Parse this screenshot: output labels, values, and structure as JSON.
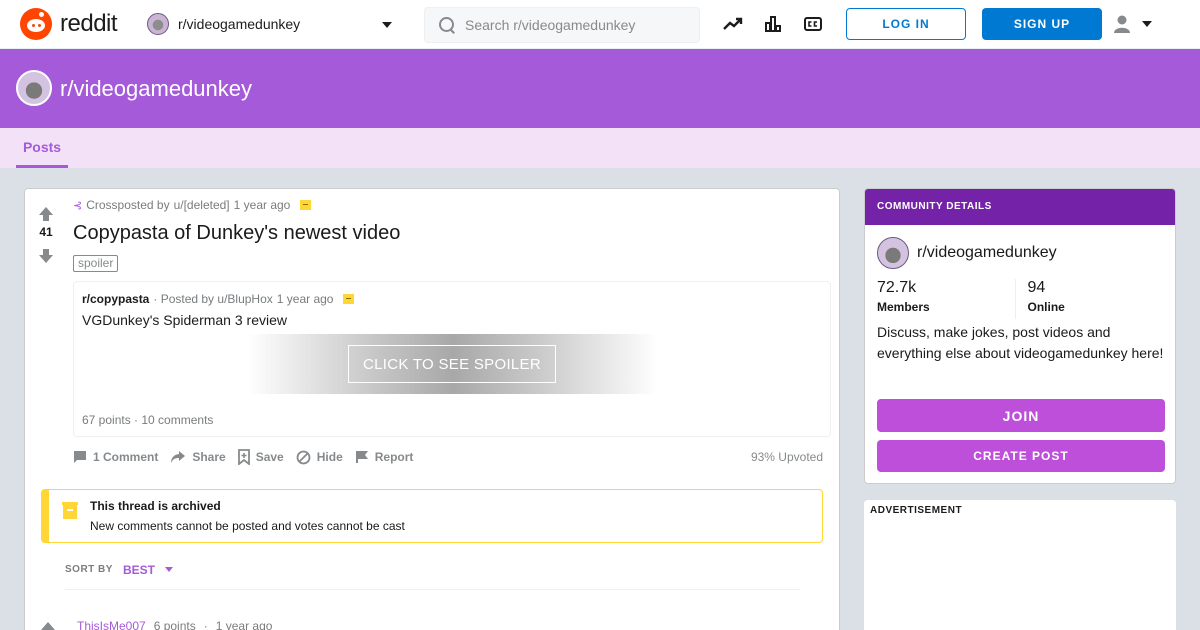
{
  "header": {
    "logo_text": "reddit",
    "community": "r/videogamedunkey",
    "search_placeholder": "Search r/videogamedunkey",
    "icons": [
      "trending-icon",
      "leaderboard-icon",
      "closed-captions-icon",
      "user-icon"
    ],
    "login_label": "LOG IN",
    "signup_label": "SIGN UP"
  },
  "banner": {
    "title": "r/videogamedunkey",
    "color": "#a45ad9"
  },
  "tabs": [
    {
      "label": "Posts"
    }
  ],
  "post": {
    "votes": "41",
    "crosspost_prefix": "Crossposted by",
    "crosspost_user": "u/[deleted]",
    "crosspost_time": "1 year ago",
    "title": "Copypasta of Dunkey's newest video",
    "flair": "spoiler",
    "embed": {
      "subreddit": "r/copypasta",
      "posted_by": "· Posted by u/BlupHox",
      "time": "1 year ago",
      "title": "VGDunkey's Spiderman 3 review",
      "spoiler_label": "CLICK TO SEE SPOILER",
      "footer": "67 points · 10 comments"
    },
    "actions": {
      "comments": "1 Comment",
      "share": "Share",
      "save": "Save",
      "hide": "Hide",
      "report": "Report"
    },
    "upvoted": "93% Upvoted",
    "archived_title": "This thread is archived",
    "archived_text": "New comments cannot be posted and votes cannot be cast",
    "sort_label": "SORT BY",
    "sort_value": "BEST",
    "comment": {
      "author": "ThisIsMe007",
      "points": "6 points",
      "separator": "·",
      "time": "1 year ago"
    }
  },
  "sidebar": {
    "head": "COMMUNITY DETAILS",
    "community": "r/videogamedunkey",
    "members_count": "72.7k",
    "members_label": "Members",
    "online_count": "94",
    "online_label": "Online",
    "description": "Discuss, make jokes, post videos and everything else about videogamedunkey here!",
    "join_label": "JOIN",
    "create_label": "CREATE POST",
    "accent": "#bd4fda"
  },
  "ad": {
    "label": "ADVERTISEMENT"
  }
}
